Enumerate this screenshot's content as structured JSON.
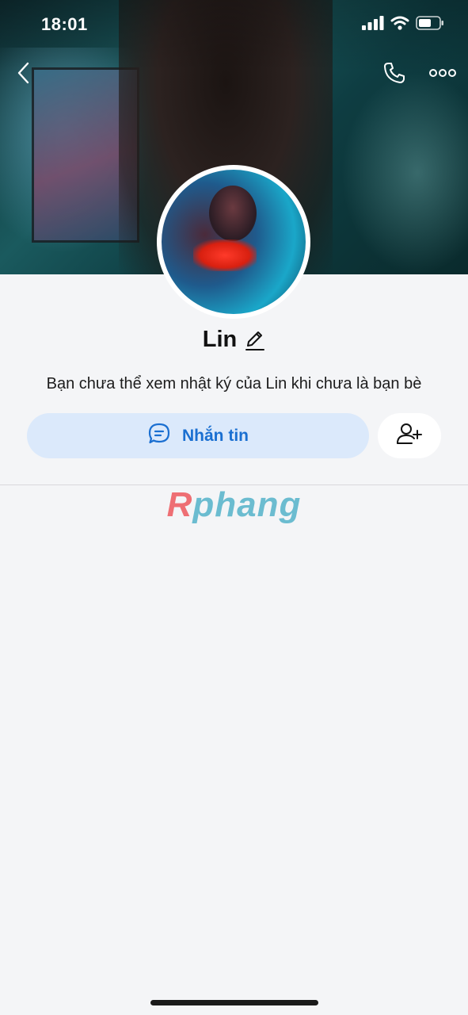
{
  "status_bar": {
    "time": "18:01"
  },
  "profile": {
    "name": "Lin",
    "privacy_notice": "Bạn chưa thể xem nhật ký của Lin khi chưa là bạn bè"
  },
  "actions": {
    "message_label": "Nhắn tin"
  },
  "watermark": {
    "first": "R",
    "rest": "phang"
  },
  "icons": {
    "back": "chevron-left-icon",
    "call": "phone-icon",
    "more": "more-dots-icon",
    "edit": "pencil-icon",
    "message": "chat-bubble-icon",
    "add_friend": "add-friend-icon",
    "signal": "signal-icon",
    "wifi": "wifi-icon",
    "battery": "battery-icon"
  },
  "colors": {
    "accent": "#1a6fd1",
    "message_button_bg": "#dbe9fb",
    "page_bg": "#f4f5f7"
  }
}
